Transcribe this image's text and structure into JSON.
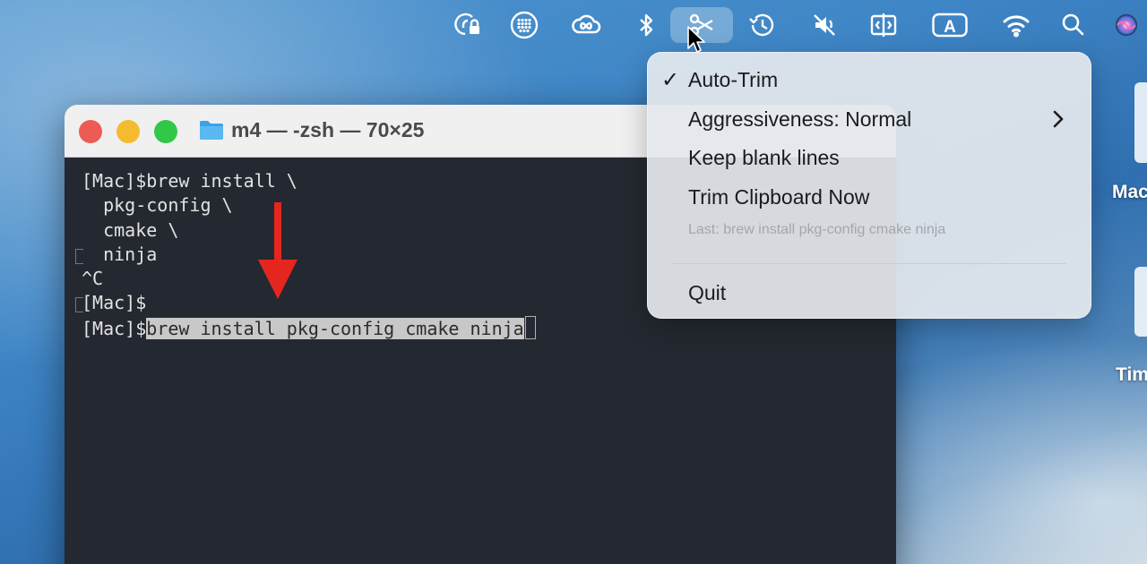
{
  "menubar": {
    "icons": [
      "password-lock-icon",
      "grid-dots-icon",
      "creative-cloud-icon",
      "bluetooth-icon",
      "scissors-icon",
      "time-machine-icon",
      "mute-icon",
      "split-view-icon",
      "input-source-icon",
      "wifi-icon",
      "search-icon",
      "siri-icon"
    ],
    "input_source_letter": "A"
  },
  "terminal": {
    "title": "m4 — -zsh — 70×25",
    "lines": [
      "[Mac]$brew install \\",
      "  pkg-config \\",
      "  cmake \\",
      "  ninja",
      "^C",
      "[Mac]$"
    ],
    "prompt": "[Mac]$",
    "selected_command": "brew install pkg-config cmake ninja"
  },
  "menu": {
    "check_mark": "✓",
    "auto_trim": "Auto-Trim",
    "aggressiveness": "Aggressiveness: Normal",
    "keep_blank_lines": "Keep blank lines",
    "trim_now": "Trim Clipboard Now",
    "last": "Last: brew install pkg-config cmake ninja",
    "quit": "Quit"
  },
  "desktop": {
    "labels": [
      "Mac",
      "Tim"
    ]
  },
  "colors": {
    "annotation_arrow": "#e5261f",
    "terminal_bg": "#242830",
    "selection": "#c8c8c8"
  }
}
